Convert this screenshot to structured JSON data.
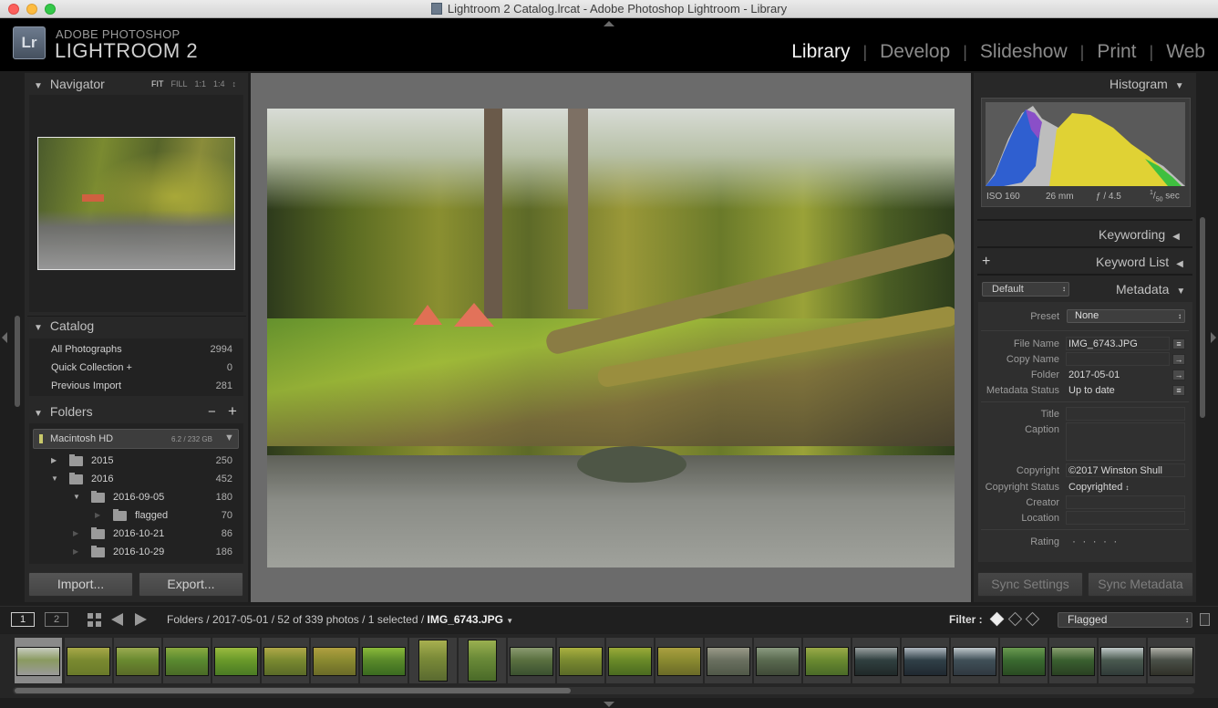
{
  "window": {
    "title": "Lightroom 2 Catalog.lrcat - Adobe Photoshop Lightroom - Library"
  },
  "identity": {
    "logo": "Lr",
    "line1": "ADOBE PHOTOSHOP",
    "line2": "LIGHTROOM 2"
  },
  "modules": [
    "Library",
    "Develop",
    "Slideshow",
    "Print",
    "Web"
  ],
  "navigator": {
    "title": "Navigator",
    "zoom_options": [
      "FIT",
      "FILL",
      "1:1",
      "1:4"
    ]
  },
  "catalog": {
    "title": "Catalog",
    "items": [
      {
        "label": "All Photographs",
        "count": "2994"
      },
      {
        "label": "Quick Collection +",
        "count": "0"
      },
      {
        "label": "Previous Import",
        "count": "281"
      }
    ]
  },
  "folders": {
    "title": "Folders",
    "add": "+",
    "remove": "−",
    "volume": {
      "name": "Macintosh HD",
      "space": "6.2 / 232 GB"
    },
    "items": [
      {
        "name": "2015",
        "count": "250"
      },
      {
        "name": "2016",
        "count": "452"
      },
      {
        "name": "2016-09-05",
        "count": "180"
      },
      {
        "name": "flagged",
        "count": "70"
      },
      {
        "name": "2016-10-21",
        "count": "86"
      },
      {
        "name": "2016-10-29",
        "count": "186"
      }
    ]
  },
  "buttons": {
    "import": "Import...",
    "export": "Export...",
    "sync_settings": "Sync Settings",
    "sync_metadata": "Sync Metadata"
  },
  "histogram": {
    "title": "Histogram",
    "iso": "ISO 160",
    "focal": "26 mm",
    "aperture": "ƒ / 4.5",
    "shutter_num": "1",
    "shutter_den": "50",
    "shutter_unit": "sec"
  },
  "keywording": {
    "title": "Keywording"
  },
  "keyword_list": {
    "title": "Keyword List",
    "add": "+"
  },
  "metadata": {
    "title": "Metadata",
    "preset_select": "Default",
    "preset_label": "Preset",
    "preset_value": "None",
    "fields": {
      "file_name": {
        "label": "File Name",
        "value": "IMG_6743.JPG"
      },
      "copy_name": {
        "label": "Copy Name",
        "value": ""
      },
      "folder": {
        "label": "Folder",
        "value": "2017-05-01"
      },
      "metadata_status": {
        "label": "Metadata Status",
        "value": "Up to date"
      },
      "title": {
        "label": "Title",
        "value": ""
      },
      "caption": {
        "label": "Caption",
        "value": ""
      },
      "copyright": {
        "label": "Copyright",
        "value": "©2017 Winston Shull"
      },
      "copyright_status": {
        "label": "Copyright Status",
        "value": "Copyrighted"
      },
      "creator": {
        "label": "Creator",
        "value": ""
      },
      "location": {
        "label": "Location",
        "value": ""
      },
      "rating": {
        "label": "Rating",
        "value": "· · · · ·"
      }
    }
  },
  "filmstrip_bar": {
    "screen1": "1",
    "screen2": "2",
    "path": "Folders / 2017-05-01 / 52 of 339 photos / 1 selected /",
    "filename": "IMG_6743.JPG",
    "filter_label": "Filter :",
    "filter_value": "Flagged"
  },
  "colors": {
    "accent": "#f2f2f2",
    "panel": "#282828",
    "background": "#1e1e1e",
    "canvas": "#6b6b6b"
  }
}
